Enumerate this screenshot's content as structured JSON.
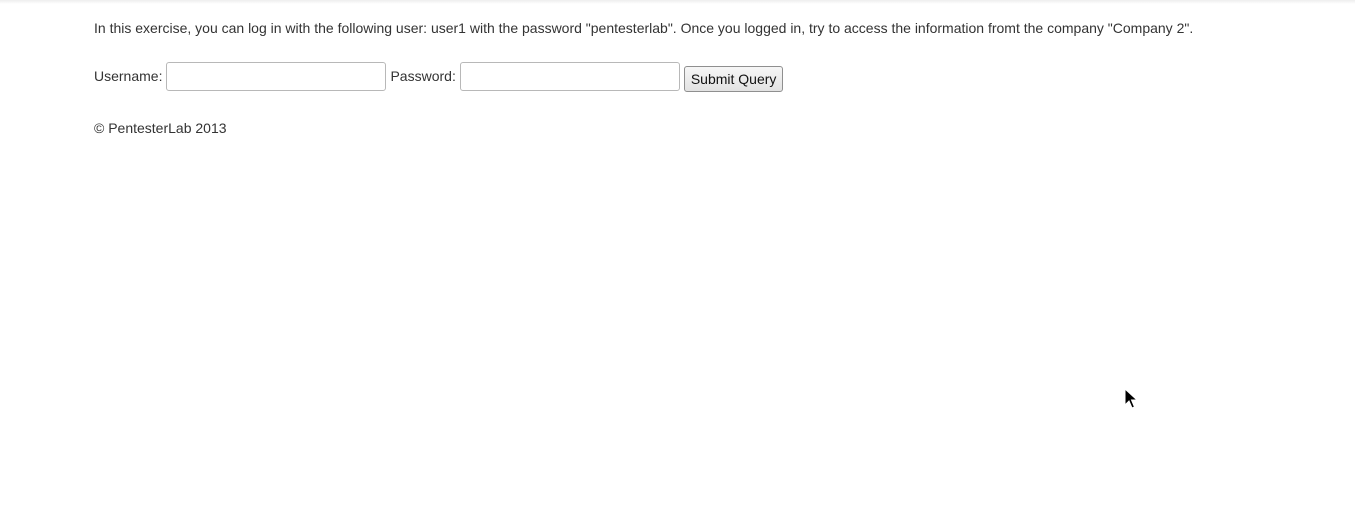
{
  "intro_text": "In this exercise, you can log in with the following user: user1 with the password \"pentesterlab\". Once you logged in, try to access the information fromt the company \"Company 2\".",
  "login_form": {
    "username_label": "Username:",
    "username_value": "",
    "password_label": "Password:",
    "password_value": "",
    "submit_label": "Submit Query"
  },
  "footer_text": "© PentesterLab 2013",
  "icons": {
    "cursor": "mouse-pointer-icon"
  }
}
